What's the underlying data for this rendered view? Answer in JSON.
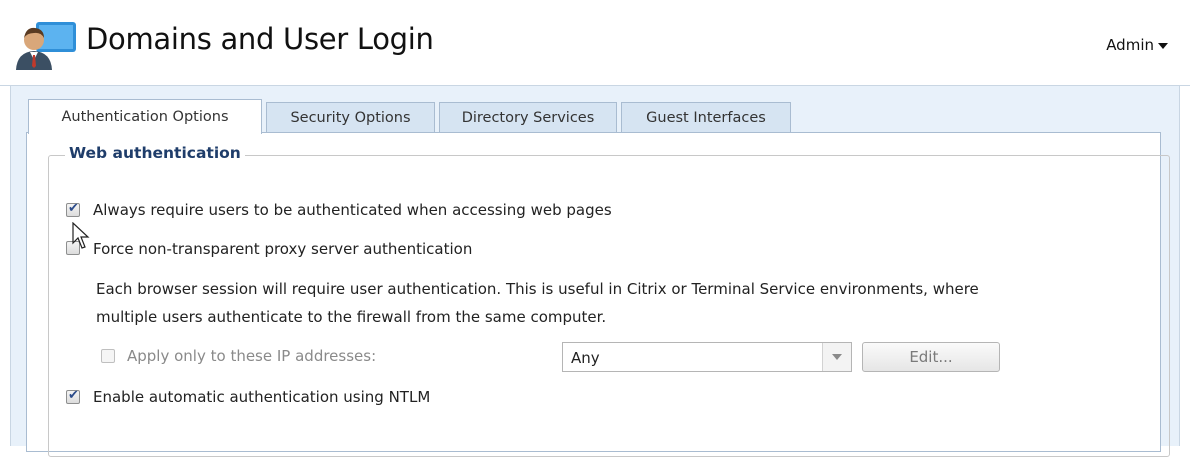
{
  "header": {
    "title": "Domains and User Login",
    "user_menu_label": "Admin"
  },
  "tabs": [
    {
      "label": "Authentication Options",
      "active": true
    },
    {
      "label": "Security Options",
      "active": false
    },
    {
      "label": "Directory Services",
      "active": false
    },
    {
      "label": "Guest Interfaces",
      "active": false
    }
  ],
  "web_auth": {
    "legend": "Web authentication",
    "always_require": {
      "label": "Always require users to be authenticated when accessing web pages",
      "checked": true
    },
    "force_proxy": {
      "label": "Force non-transparent proxy server authentication",
      "checked": false
    },
    "description_line1": "Each browser session will require user authentication. This is useful in Citrix or Terminal Service environments, where",
    "description_line2": "multiple users authenticate to the firewall from the same computer.",
    "apply_only": {
      "label": "Apply only to these IP addresses:",
      "checked": false,
      "enabled": false
    },
    "ip_select_value": "Any",
    "edit_button": "Edit...",
    "ntlm": {
      "label": "Enable automatic authentication using NTLM",
      "checked": true
    }
  },
  "colors": {
    "content_bg": "#e8f1fa",
    "legend": "#1f3d6a",
    "check": "#2b4b8a"
  }
}
